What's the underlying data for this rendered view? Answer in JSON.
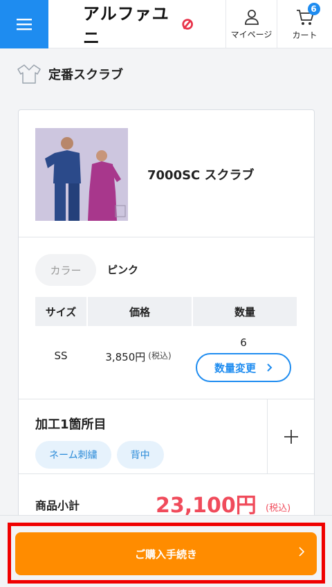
{
  "header": {
    "logo_text": "アルファユニ",
    "mypage_label": "マイページ",
    "cart_label": "カート",
    "cart_count": "6"
  },
  "section": {
    "title": "定番スクラブ"
  },
  "product": {
    "name": "7000SC スクラブ",
    "color_label": "カラー",
    "color_value": "ピンク"
  },
  "table": {
    "headers": [
      "サイズ",
      "価格",
      "数量"
    ],
    "size": "SS",
    "price": "3,850円",
    "price_tax": "(税込)",
    "quantity": "6",
    "qty_button": "数量変更"
  },
  "processing": {
    "title": "加工1箇所目",
    "tags": [
      "ネーム刺繍",
      "背中"
    ]
  },
  "subtotal": {
    "label": "商品小計",
    "amount": "23,100円",
    "tax": "(税込)"
  },
  "footer": {
    "checkout_label": "ご購入手続き"
  },
  "colors": {
    "accent": "#1e8cf0",
    "price": "#f04b5b",
    "checkout": "#ff8c00",
    "highlight": "#f00000"
  },
  "icons": [
    "menu-icon",
    "user-icon",
    "cart-icon",
    "scrub-shirt-icon",
    "chevron-right-icon",
    "plus-icon"
  ]
}
